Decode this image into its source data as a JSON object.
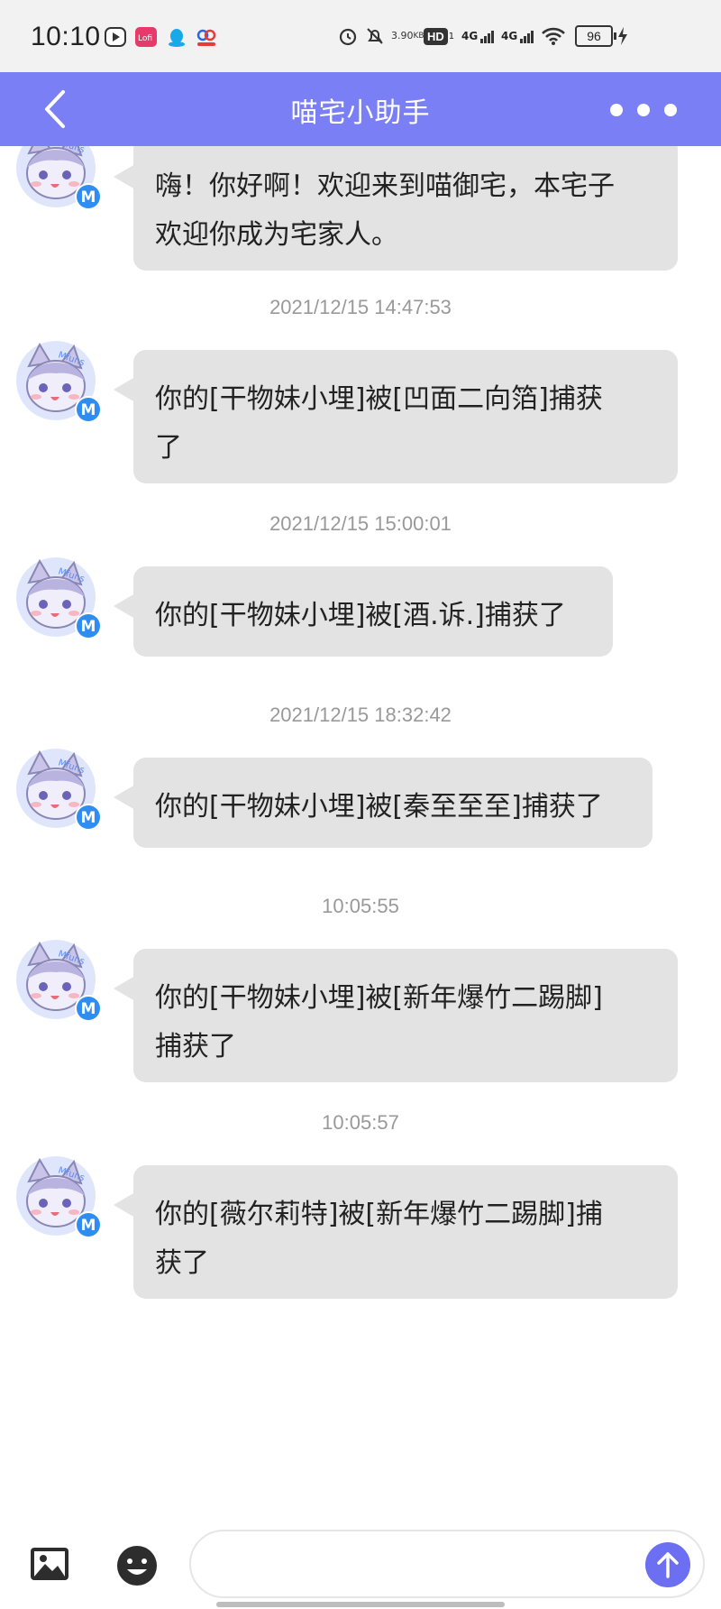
{
  "status_bar": {
    "time": "10:10",
    "net_speed_value": "3.90",
    "net_speed_unit": "KB/s",
    "hd_label": "HD",
    "signal_1": "4G",
    "signal_2": "4G",
    "battery": "96",
    "icons": [
      "video-app-icon",
      "lofter-app-icon",
      "qq-icon",
      "baidu-netdisk-icon",
      "alarm-icon",
      "mute-icon",
      "hd-icon",
      "signal-4g-icon",
      "signal-4g-icon",
      "wifi-icon",
      "battery-icon",
      "charging-icon"
    ]
  },
  "title_bar": {
    "title": "喵宅小助手",
    "back_icon": "chevron-left-icon",
    "more_icon": "more-horizontal-icon",
    "color": "#7b7ff5"
  },
  "messages": [
    {
      "timestamp": "",
      "text_lines": [
        "嗨！你好啊！欢迎来到喵御宅，本宅子",
        "欢迎你成为宅家人。"
      ]
    },
    {
      "timestamp": "2021/12/15 14:47:53",
      "text_lines": [
        "你的[干物妹小埋]被[凹面二向箔]捕获",
        "了"
      ]
    },
    {
      "timestamp": "2021/12/15 15:00:01",
      "text_lines": [
        "你的[干物妹小埋]被[酒.诉.]捕获了"
      ]
    },
    {
      "timestamp": "2021/12/15 18:32:42",
      "text_lines": [
        "你的[干物妹小埋]被[秦至至至]捕获了"
      ]
    },
    {
      "timestamp": "10:05:55",
      "text_lines": [
        "你的[干物妹小埋]被[新年爆竹二踢脚]",
        "捕获了"
      ]
    },
    {
      "timestamp": "10:05:57",
      "text_lines": [
        "你的[薇尔莉特]被[新年爆竹二踢脚]捕",
        "获了"
      ]
    }
  ],
  "avatar": {
    "badge_letter": "M",
    "badge_color": "#2f8cf0",
    "watermark": "Mfuns"
  },
  "input_bar": {
    "placeholder": "",
    "image_icon": "image-icon",
    "emoji_icon": "emoji-icon",
    "send_icon": "arrow-up-icon",
    "send_color": "#6c6ff2"
  }
}
